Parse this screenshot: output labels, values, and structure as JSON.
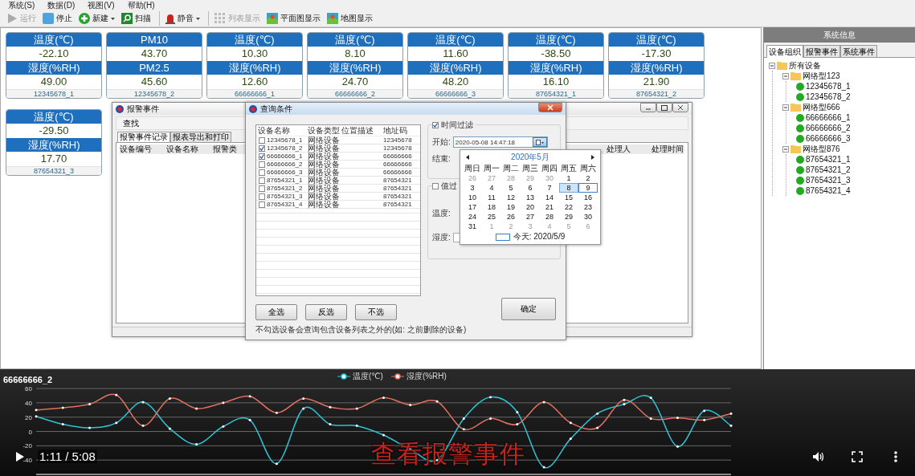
{
  "menu": [
    "系统(S)",
    "数据(D)",
    "视图(V)",
    "帮助(H)"
  ],
  "toolbar": [
    {
      "label": "运行",
      "disabled": true,
      "dropdown": false,
      "separator_before": false
    },
    {
      "label": "停止",
      "disabled": false,
      "dropdown": false,
      "separator_before": false
    },
    {
      "label": "新建",
      "disabled": false,
      "dropdown": true,
      "separator_before": false
    },
    {
      "label": "扫描",
      "disabled": false,
      "dropdown": false,
      "separator_before": false
    },
    {
      "label": "静音",
      "disabled": false,
      "dropdown": true,
      "separator_before": true
    },
    {
      "label": "列表显示",
      "disabled": true,
      "dropdown": false,
      "separator_before": true
    },
    {
      "label": "平面图显示",
      "disabled": false,
      "dropdown": false,
      "separator_before": false
    },
    {
      "label": "地图显示",
      "disabled": false,
      "dropdown": false,
      "separator_before": false
    }
  ],
  "cards": [
    {
      "top_label": "温度(℃)",
      "top_value": "-22.10",
      "bottom_label": "湿度(%RH)",
      "bottom_value": "49.00",
      "device": "12345678_1"
    },
    {
      "top_label": "PM10",
      "top_value": "43.70",
      "bottom_label": "PM2.5",
      "bottom_value": "45.60",
      "device": "12345678_2"
    },
    {
      "top_label": "温度(℃)",
      "top_value": "10.30",
      "bottom_label": "湿度(%RH)",
      "bottom_value": "12.60",
      "device": "66666666_1"
    },
    {
      "top_label": "温度(℃)",
      "top_value": "8.10",
      "bottom_label": "湿度(%RH)",
      "bottom_value": "24.70",
      "device": "66666666_2"
    },
    {
      "top_label": "温度(℃)",
      "top_value": "11.60",
      "bottom_label": "湿度(%RH)",
      "bottom_value": "48.20",
      "device": "66666666_3"
    },
    {
      "top_label": "温度(℃)",
      "top_value": "-38.50",
      "bottom_label": "湿度(%RH)",
      "bottom_value": "16.10",
      "device": "87654321_1"
    },
    {
      "top_label": "温度(℃)",
      "top_value": "-17.30",
      "bottom_label": "湿度(%RH)",
      "bottom_value": "21.90",
      "device": "87654321_2"
    },
    {
      "top_label": "温度(℃)",
      "top_value": "-29.50",
      "bottom_label": "湿度(%RH)",
      "bottom_value": "17.70",
      "device": "87654321_3"
    }
  ],
  "alarm_window": {
    "title": "报警事件",
    "toolbar_button": "查找",
    "tabs": [
      {
        "label": "报警事件记录",
        "selected": true
      },
      {
        "label": "报表导出和打印",
        "selected": false
      }
    ],
    "columns": [
      "设备编号",
      "设备名称",
      "报警类",
      "处理人",
      "处理时间"
    ]
  },
  "query_window": {
    "title": "查询条件",
    "columns": [
      "设备名称",
      "设备类型",
      "位置描述",
      "地址码"
    ],
    "rows": [
      {
        "name": "12345678_1",
        "type": "网络设备",
        "address": "12345678",
        "checked": false
      },
      {
        "name": "12345678_2",
        "type": "网络设备",
        "address": "12345678",
        "checked": true
      },
      {
        "name": "66666666_1",
        "type": "网络设备",
        "address": "66666666",
        "checked": true
      },
      {
        "name": "66666666_2",
        "type": "网络设备",
        "address": "66666666",
        "checked": false
      },
      {
        "name": "66666666_3",
        "type": "网络设备",
        "address": "66666666",
        "checked": false
      },
      {
        "name": "87654321_1",
        "type": "网络设备",
        "address": "87654321",
        "checked": false
      },
      {
        "name": "87654321_2",
        "type": "网络设备",
        "address": "87654321",
        "checked": false
      },
      {
        "name": "87654321_3",
        "type": "网络设备",
        "address": "87654321",
        "checked": false
      },
      {
        "name": "87654321_4",
        "type": "网络设备",
        "address": "87654321",
        "checked": false
      }
    ],
    "buttons": [
      "全选",
      "反选",
      "不选"
    ],
    "note": "不勾选设备会查询包含设备列表之外的(如: 之前删除的设备)",
    "time_filter": {
      "label": "时间过滤",
      "checked": true,
      "start_label": "开始:",
      "start_value": "2020-05-08 14:47:18",
      "end_label": "结束:"
    },
    "value_filter": {
      "label": "值过",
      "checked": false,
      "temp_label": "温度:",
      "humid_label": "湿度:"
    },
    "confirm": "确定"
  },
  "calendar": {
    "month": "2020年5月",
    "weekdays": [
      "周日",
      "周一",
      "周二",
      "周三",
      "周四",
      "周五",
      "周六"
    ],
    "days": [
      {
        "label": "26",
        "muted": true,
        "selected": false,
        "today": false
      },
      {
        "label": "27",
        "muted": true,
        "selected": false,
        "today": false
      },
      {
        "label": "28",
        "muted": true,
        "selected": false,
        "today": false
      },
      {
        "label": "29",
        "muted": true,
        "selected": false,
        "today": false
      },
      {
        "label": "30",
        "muted": true,
        "selected": false,
        "today": false
      },
      {
        "label": "1",
        "muted": false,
        "selected": false,
        "today": false
      },
      {
        "label": "2",
        "muted": false,
        "selected": false,
        "today": false
      },
      {
        "label": "3",
        "muted": false,
        "selected": false,
        "today": false
      },
      {
        "label": "4",
        "muted": false,
        "selected": false,
        "today": false
      },
      {
        "label": "5",
        "muted": false,
        "selected": false,
        "today": false
      },
      {
        "label": "6",
        "muted": false,
        "selected": false,
        "today": false
      },
      {
        "label": "7",
        "muted": false,
        "selected": false,
        "today": false
      },
      {
        "label": "8",
        "muted": false,
        "selected": true,
        "today": false
      },
      {
        "label": "9",
        "muted": false,
        "selected": false,
        "today": true
      },
      {
        "label": "10",
        "muted": false,
        "selected": false,
        "today": false
      },
      {
        "label": "11",
        "muted": false,
        "selected": false,
        "today": false
      },
      {
        "label": "12",
        "muted": false,
        "selected": false,
        "today": false
      },
      {
        "label": "13",
        "muted": false,
        "selected": false,
        "today": false
      },
      {
        "label": "14",
        "muted": false,
        "selected": false,
        "today": false
      },
      {
        "label": "15",
        "muted": false,
        "selected": false,
        "today": false
      },
      {
        "label": "16",
        "muted": false,
        "selected": false,
        "today": false
      },
      {
        "label": "17",
        "muted": false,
        "selected": false,
        "today": false
      },
      {
        "label": "18",
        "muted": false,
        "selected": false,
        "today": false
      },
      {
        "label": "19",
        "muted": false,
        "selected": false,
        "today": false
      },
      {
        "label": "20",
        "muted": false,
        "selected": false,
        "today": false
      },
      {
        "label": "21",
        "muted": false,
        "selected": false,
        "today": false
      },
      {
        "label": "22",
        "muted": false,
        "selected": false,
        "today": false
      },
      {
        "label": "23",
        "muted": false,
        "selected": false,
        "today": false
      },
      {
        "label": "24",
        "muted": false,
        "selected": false,
        "today": false
      },
      {
        "label": "25",
        "muted": false,
        "selected": false,
        "today": false
      },
      {
        "label": "26",
        "muted": false,
        "selected": false,
        "today": false
      },
      {
        "label": "27",
        "muted": false,
        "selected": false,
        "today": false
      },
      {
        "label": "28",
        "muted": false,
        "selected": false,
        "today": false
      },
      {
        "label": "29",
        "muted": false,
        "selected": false,
        "today": false
      },
      {
        "label": "30",
        "muted": false,
        "selected": false,
        "today": false
      },
      {
        "label": "31",
        "muted": false,
        "selected": false,
        "today": false
      },
      {
        "label": "1",
        "muted": true,
        "selected": false,
        "today": false
      },
      {
        "label": "2",
        "muted": true,
        "selected": false,
        "today": false
      },
      {
        "label": "3",
        "muted": true,
        "selected": false,
        "today": false
      },
      {
        "label": "4",
        "muted": true,
        "selected": false,
        "today": false
      },
      {
        "label": "5",
        "muted": true,
        "selected": false,
        "today": false
      },
      {
        "label": "6",
        "muted": true,
        "selected": false,
        "today": false
      }
    ],
    "footer": "今天: 2020/5/9"
  },
  "sidebar": {
    "title": "系统信息",
    "tabs": [
      {
        "label": "设备组织",
        "selected": true
      },
      {
        "label": "报警事件",
        "selected": false
      },
      {
        "label": "系统事件",
        "selected": false
      }
    ],
    "tree": [
      {
        "label": "所有设备",
        "expanded": true,
        "children": [
          {
            "label": "网络型123",
            "expanded": true,
            "children": [
              {
                "label": "12345678_1",
                "color": "#22aa22"
              },
              {
                "label": "12345678_2",
                "color": "#22aa22"
              }
            ]
          },
          {
            "label": "网络型666",
            "expanded": true,
            "children": [
              {
                "label": "66666666_1",
                "color": "#22aa22"
              },
              {
                "label": "66666666_2",
                "color": "#22aa22"
              },
              {
                "label": "66666666_3",
                "color": "#22aa22"
              }
            ]
          },
          {
            "label": "网络型876",
            "expanded": true,
            "children": [
              {
                "label": "87654321_1",
                "color": "#22aa22"
              },
              {
                "label": "87654321_2",
                "color": "#22aa22"
              },
              {
                "label": "87654321_3",
                "color": "#22aa22"
              },
              {
                "label": "87654321_4",
                "color": "#22aa22"
              }
            ]
          }
        ]
      }
    ]
  },
  "chart_panel": {
    "title": "66666666_2",
    "chart_data": {
      "type": "line",
      "grid": true,
      "ylim": [
        -60,
        60
      ],
      "yticks": [
        60,
        40,
        20,
        0,
        -20,
        -40
      ],
      "series": [
        {
          "name": "温度(℃)",
          "color": "#2ec4d6",
          "values": [
            21,
            10,
            5,
            12,
            41,
            4,
            -18,
            7,
            16,
            -45,
            32,
            10,
            8,
            -5,
            -25,
            -40,
            18,
            48,
            27,
            -50,
            -10,
            25,
            38,
            47,
            -21,
            29,
            8
          ]
        },
        {
          "name": "湿度(%RH)",
          "color": "#e0705f",
          "values": [
            30,
            33,
            38,
            51,
            8,
            46,
            32,
            40,
            49,
            26,
            46,
            34,
            32,
            47,
            37,
            42,
            3,
            18,
            10,
            41,
            12,
            5,
            44,
            18,
            19,
            16,
            25
          ]
        }
      ]
    }
  },
  "video": {
    "time": "1:11 / 5:08",
    "caption": "查看报警事件"
  }
}
